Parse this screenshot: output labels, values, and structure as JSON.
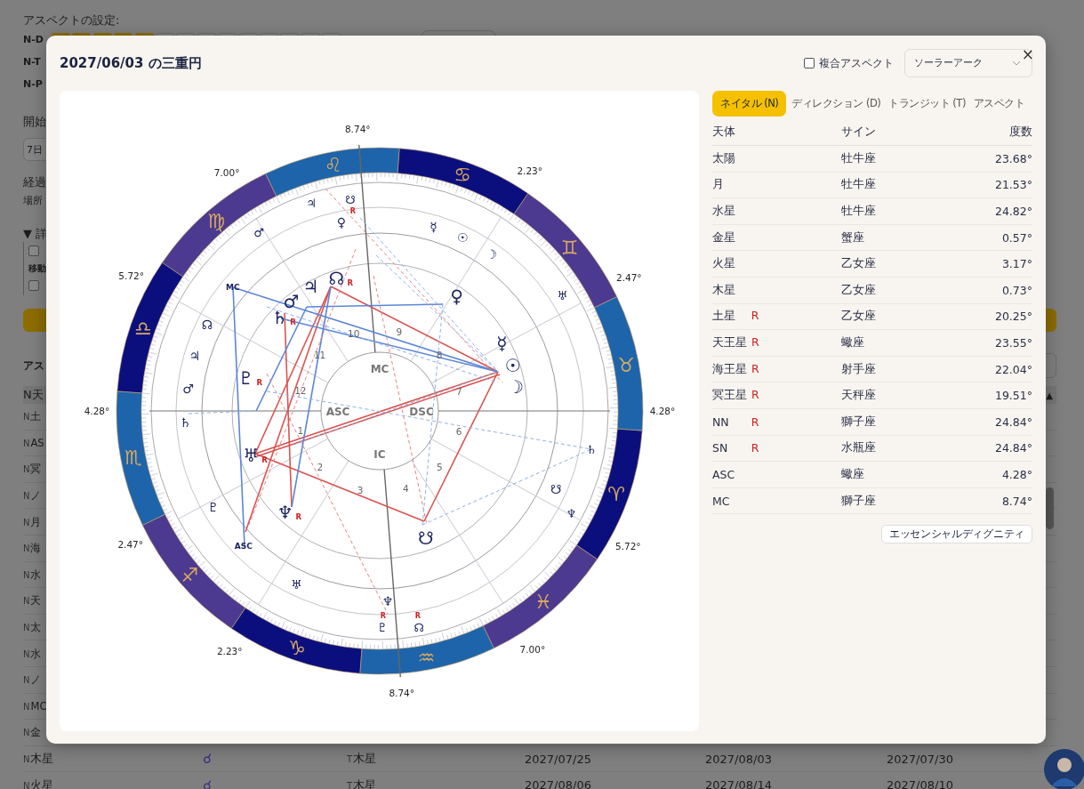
{
  "background": {
    "settings_title": "アスペクトの設定:",
    "orb_rows": [
      {
        "label": "N-D",
        "toggles": [
          {
            "on": true
          },
          {
            "on": true
          },
          {
            "on": true
          },
          {
            "on": true
          },
          {
            "on": true
          },
          {
            "on": false
          },
          {
            "on": false
          },
          {
            "on": false
          },
          {
            "on": false
          },
          {
            "on": false
          },
          {
            "on": false
          },
          {
            "on": false
          },
          {
            "on": false
          },
          {
            "on": false
          }
        ]
      },
      {
        "label": "N-T"
      },
      {
        "label": "N-P"
      }
    ],
    "start_label": "開始",
    "period_field": "7日",
    "elapsed_label": "経過",
    "place_label": "場所",
    "details_toggle": "▼ 詳",
    "details": {
      "checkbox_1": {
        "checked": false
      },
      "move_label": "移動",
      "checkbox_2": {
        "checked": false
      }
    },
    "aspects_title": "アス",
    "aspect_list": {
      "header": "N天",
      "sort_icon": "▲",
      "rows": [
        {
          "prefix": "N",
          "body": "土"
        },
        {
          "prefix": "N",
          "body": "AS"
        },
        {
          "prefix": "N",
          "body": "冥"
        },
        {
          "prefix": "N",
          "body": "ノ"
        },
        {
          "prefix": "N",
          "body": "月"
        },
        {
          "prefix": "N",
          "body": "海"
        },
        {
          "prefix": "N",
          "body": "水"
        },
        {
          "prefix": "N",
          "body": "天"
        },
        {
          "prefix": "N",
          "body": "太"
        },
        {
          "prefix": "N",
          "body": "水"
        },
        {
          "prefix": "N",
          "body": "ノ"
        },
        {
          "prefix": "N",
          "body": "MC"
        },
        {
          "prefix": "N",
          "body": "金"
        },
        {
          "prefix": "N",
          "body": "木星",
          "aspect": "☌",
          "target_prefix": "T",
          "target": "木星",
          "date_1": "2027/07/25",
          "date_2": "2027/08/03",
          "date_3": "2027/07/30"
        },
        {
          "prefix": "N",
          "body": "火星",
          "aspect": "☌",
          "target_prefix": "T",
          "target": "木星",
          "date_1": "2027/08/06",
          "date_2": "2027/08/14",
          "date_3": "2027/08/10"
        }
      ]
    }
  },
  "modal": {
    "title": "2027/06/03 の三重円",
    "composite_aspect": {
      "label": "複合アスペクト",
      "checked": false
    },
    "method_select": {
      "value": "ソーラーアーク"
    },
    "close": "×",
    "chart": {
      "signs": [
        "♈",
        "♉",
        "♊",
        "♋",
        "♌",
        "♍",
        "♎",
        "♏",
        "♐",
        "♑",
        "♒",
        "♓"
      ],
      "cusp_labels": [
        "4.28°",
        "2.47°",
        "2.23°",
        "8.74°",
        "7.00°",
        "5.72°",
        "4.28°",
        "2.47°",
        "2.23°",
        "8.74°",
        "7.00°",
        "5.72°"
      ],
      "house_numbers": [
        "1",
        "2",
        "3",
        "4",
        "5",
        "6",
        "7",
        "8",
        "9",
        "10",
        "11",
        "12"
      ],
      "angles": [
        "ASC",
        "IC",
        "DSC",
        "MC"
      ],
      "natal": [
        {
          "glyph": "☉"
        },
        {
          "glyph": "☽"
        },
        {
          "glyph": "☿"
        },
        {
          "glyph": "♀"
        },
        {
          "glyph": "♂"
        },
        {
          "glyph": "♃"
        },
        {
          "glyph": "♄",
          "mark": "R"
        },
        {
          "glyph": "♅",
          "mark": "R"
        },
        {
          "glyph": "♆",
          "mark": "R"
        },
        {
          "glyph": "♇",
          "mark": "R"
        },
        {
          "glyph": "☊",
          "mark": "R"
        },
        {
          "glyph": "☋"
        }
      ],
      "direction": [
        {
          "glyph": "☉"
        },
        {
          "glyph": "☽"
        },
        {
          "glyph": "☿"
        },
        {
          "glyph": "♀"
        },
        {
          "glyph": "♂"
        },
        {
          "glyph": "♃"
        },
        {
          "glyph": "♄"
        },
        {
          "glyph": "♅"
        },
        {
          "glyph": "♆"
        },
        {
          "glyph": "♇"
        },
        {
          "glyph": "☊"
        },
        {
          "glyph": "☋"
        },
        {
          "glyph": "ASC"
        },
        {
          "glyph": "MC"
        }
      ],
      "transit": [
        {
          "glyph": "♃"
        },
        {
          "glyph": "☋",
          "mark": "R"
        },
        {
          "glyph": "♂"
        },
        {
          "glyph": "♅"
        },
        {
          "glyph": "♄"
        },
        {
          "glyph": "♆"
        },
        {
          "glyph": "♇",
          "mark": "R"
        },
        {
          "glyph": "☊",
          "mark": "R"
        }
      ]
    },
    "tabs": [
      {
        "label": "ネイタル (N)",
        "selected": true
      },
      {
        "label": "ディレクション (D)",
        "selected": false
      },
      {
        "label": "トランジット (T)",
        "selected": false
      },
      {
        "label": "アスペクト",
        "selected": false
      }
    ],
    "table": {
      "columns": [
        "天体",
        "サイン",
        "度数"
      ],
      "rows": [
        {
          "body": "太陽",
          "sign": "牡牛座",
          "degree": "23.68°"
        },
        {
          "body": "月",
          "sign": "牡牛座",
          "degree": "21.53°"
        },
        {
          "body": "水星",
          "sign": "牡牛座",
          "degree": "24.82°"
        },
        {
          "body": "金星",
          "sign": "蟹座",
          "degree": "0.57°"
        },
        {
          "body": "火星",
          "sign": "乙女座",
          "degree": "3.17°"
        },
        {
          "body": "木星",
          "sign": "乙女座",
          "degree": "0.73°"
        },
        {
          "body": "土星",
          "mark": "R",
          "sign": "乙女座",
          "degree": "20.25°"
        },
        {
          "body": "天王星",
          "mark": "R",
          "sign": "蠍座",
          "degree": "23.55°"
        },
        {
          "body": "海王星",
          "mark": "R",
          "sign": "射手座",
          "degree": "22.04°"
        },
        {
          "body": "冥王星",
          "mark": "R",
          "sign": "天秤座",
          "degree": "19.51°"
        },
        {
          "body": "NN",
          "mark": "R",
          "sign": "獅子座",
          "degree": "24.84°"
        },
        {
          "body": "SN",
          "mark": "R",
          "sign": "水瓶座",
          "degree": "24.84°"
        },
        {
          "body": "ASC",
          "sign": "蠍座",
          "degree": "4.28°"
        },
        {
          "body": "MC",
          "sign": "獅子座",
          "degree": "8.74°"
        }
      ]
    },
    "dignity_button": "エッセンシャルディグニティ"
  }
}
